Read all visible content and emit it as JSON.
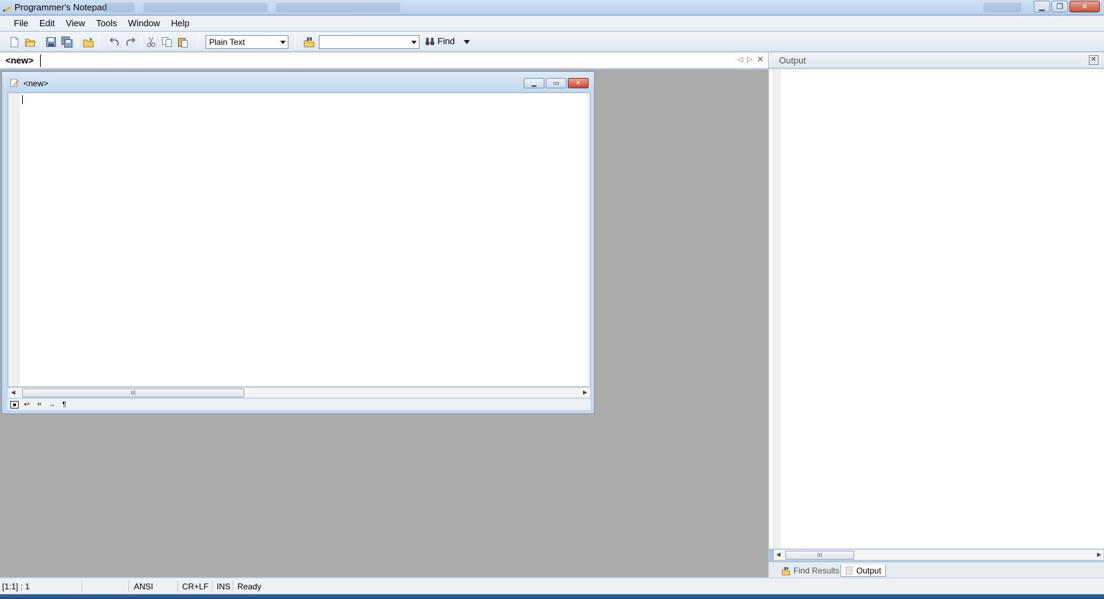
{
  "window": {
    "title": "Programmer's Notepad"
  },
  "menu": [
    "File",
    "Edit",
    "View",
    "Tools",
    "Window",
    "Help"
  ],
  "toolbar": {
    "scheme_select": "Plain Text",
    "search_combo_value": "",
    "find_label": "Find",
    "icons": [
      "new-file-icon",
      "open-file-icon",
      "save-icon",
      "save-all-icon",
      "open-folder-icon",
      "undo-icon",
      "redo-icon",
      "cut-icon",
      "copy-icon",
      "paste-icon",
      "find-in-files-icon",
      "binoculars-icon"
    ]
  },
  "tabs": {
    "active_label": "<new>"
  },
  "document": {
    "title": "<new>",
    "content": ""
  },
  "output_panel": {
    "title": "Output",
    "tabs": [
      "Find Results",
      "Output"
    ],
    "active_tab": "Output"
  },
  "statusbar": {
    "position": "[1:1] : 1",
    "encoding": "ANSI",
    "line_endings": "CR+LF",
    "insert_mode": "INS",
    "status": "Ready"
  },
  "colors": {
    "titlebar": "#b9d1ea",
    "mdi_background": "#ababab",
    "close_button": "#c7503a"
  }
}
